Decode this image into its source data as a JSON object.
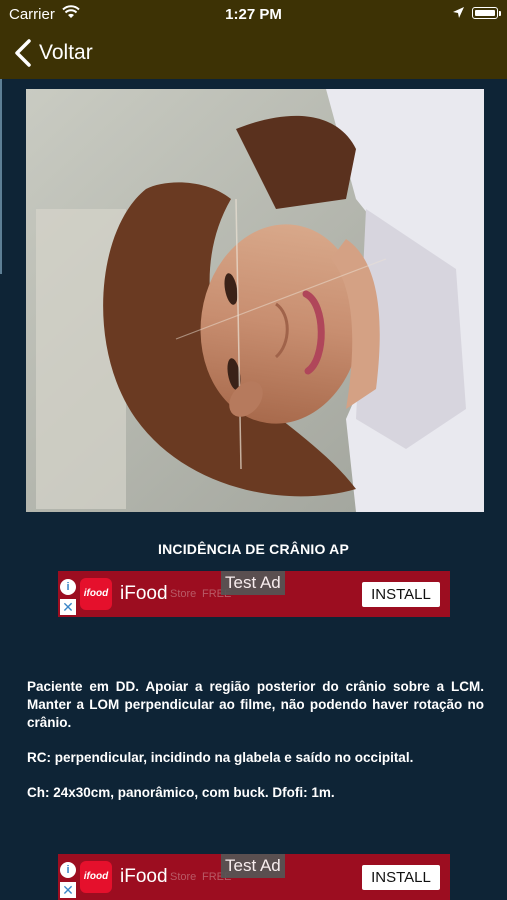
{
  "status_bar": {
    "carrier": "Carrier",
    "time": "1:27 PM"
  },
  "nav": {
    "back_label": "Voltar"
  },
  "content": {
    "title": "INCIDÊNCIA DE CRÂNIO AP",
    "paragraphs": [
      "Paciente em DD. Apoiar a região posterior do crânio sobre a LCM. Manter a LOM perpendicular ao filme, não podendo haver rotação no crânio.",
      "RC: perpendicular, incidindo na glabela e saído no occipital.",
      "Ch: 24x30cm, panorâmico, com buck. Dfofi: 1m."
    ]
  },
  "ads": [
    {
      "app_name": "iFood",
      "logo_text": "ifood",
      "test_label": "Test Ad",
      "install_label": "INSTALL",
      "ghost_store": "Store",
      "ghost_price": "FREE"
    },
    {
      "app_name": "iFood",
      "logo_text": "ifood",
      "test_label": "Test Ad",
      "install_label": "INSTALL",
      "ghost_store": "Store",
      "ghost_price": "FREE"
    }
  ],
  "colors": {
    "nav_bg": "#3d3205",
    "page_bg": "#0e2436",
    "ad_bg": "#9c0d20"
  }
}
